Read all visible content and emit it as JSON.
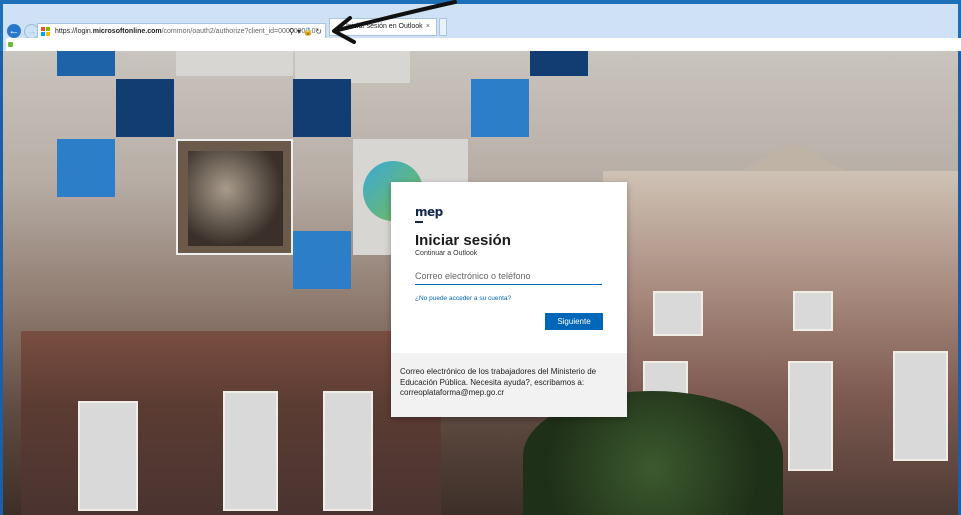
{
  "browser": {
    "url_prefix": "https://login.",
    "url_domain": "microsoftonline.com",
    "url_path": "/common/oauth2/authorize?client_id=00000002-0",
    "tab_title": "Iniciar sesión en Outlook",
    "tab_close": "×"
  },
  "login": {
    "logo_text": "mep",
    "title": "Iniciar sesión",
    "subtitle": "Continuar a Outlook",
    "email_placeholder": "Correo electrónico o teléfono",
    "cant_access_link": "¿No puede acceder a su cuenta?",
    "next_button": "Siguiente",
    "footer_text": "Correo electrónico de los trabajadores del Ministerio de Educación Pública. Necesita ayuda?, escribamos a: correoplataforma@mep.go.cr"
  },
  "colors": {
    "accent": "#0067b8",
    "chrome": "#1d6fb8"
  }
}
